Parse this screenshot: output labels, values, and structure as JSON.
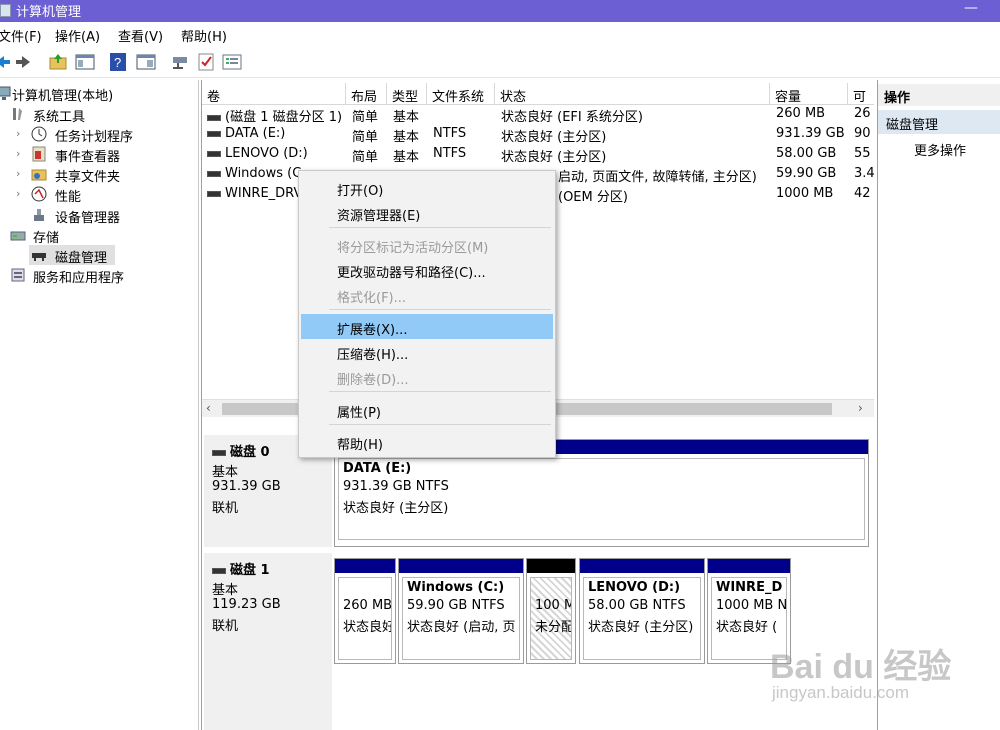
{
  "window": {
    "title": "计算机管理"
  },
  "menu": [
    "文件(F)",
    "操作(A)",
    "查看(V)",
    "帮助(H)"
  ],
  "tree": {
    "root": "计算机管理(本地)",
    "system_tools": "系统工具",
    "task_scheduler": "任务计划程序",
    "event_viewer": "事件查看器",
    "shared_folders": "共享文件夹",
    "performance": "性能",
    "device_manager": "设备管理器",
    "storage": "存储",
    "disk_management": "磁盘管理",
    "services_apps": "服务和应用程序"
  },
  "volume_list": {
    "columns": [
      "卷",
      "布局",
      "类型",
      "文件系统",
      "状态",
      "容量",
      "可"
    ],
    "rows": [
      {
        "volume": "(磁盘 1 磁盘分区 1)",
        "layout": "简单",
        "type": "基本",
        "fs": "",
        "status": "状态良好 (EFI 系统分区)",
        "capacity": "260 MB",
        "free": "26"
      },
      {
        "volume": "DATA (E:)",
        "layout": "简单",
        "type": "基本",
        "fs": "NTFS",
        "status": "状态良好 (主分区)",
        "capacity": "931.39 GB",
        "free": "90"
      },
      {
        "volume": "LENOVO (D:)",
        "layout": "简单",
        "type": "基本",
        "fs": "NTFS",
        "status": "状态良好 (主分区)",
        "capacity": "58.00 GB",
        "free": "55"
      },
      {
        "volume": "Windows (C",
        "layout": "",
        "type": "",
        "fs": "",
        "status": "启动, 页面文件, 故障转储, 主分区)",
        "capacity": "59.90 GB",
        "free": "3.4"
      },
      {
        "volume": "WINRE_DRV",
        "layout": "",
        "type": "",
        "fs": "",
        "status": "(OEM 分区)",
        "capacity": "1000 MB",
        "free": "42"
      }
    ]
  },
  "disks": [
    {
      "name": "磁盘 0",
      "kind": "基本",
      "size": "931.39 GB",
      "state": "联机",
      "partitions": [
        {
          "name": "DATA  (E:)",
          "line2": "931.39 GB NTFS",
          "line3": "状态良好 (主分区)"
        }
      ]
    },
    {
      "name": "磁盘 1",
      "kind": "基本",
      "size": "119.23 GB",
      "state": "联机",
      "partitions": [
        {
          "name": "",
          "line2": "260 MB",
          "line3": "状态良好"
        },
        {
          "name": "Windows  (C:)",
          "line2": "59.90 GB NTFS",
          "line3": "状态良好 (启动, 页"
        },
        {
          "name": "",
          "line2": "100 M",
          "line3": "未分配"
        },
        {
          "name": "LENOVO  (D:)",
          "line2": "58.00 GB NTFS",
          "line3": "状态良好 (主分区)"
        },
        {
          "name": "WINRE_D",
          "line2": "1000 MB N",
          "line3": "状态良好 ("
        }
      ]
    }
  ],
  "context_menu": {
    "open": "打开(O)",
    "explorer": "资源管理器(E)",
    "mark_active": "将分区标记为活动分区(M)",
    "change_letter": "更改驱动器号和路径(C)...",
    "format": "格式化(F)...",
    "extend": "扩展卷(X)...",
    "shrink": "压缩卷(H)...",
    "delete": "删除卷(D)...",
    "properties": "属性(P)",
    "help": "帮助(H)"
  },
  "actions": {
    "header": "操作",
    "selected": "磁盘管理",
    "more": "更多操作"
  },
  "watermark": {
    "brand": "Bai du 经验",
    "url": "jingyan.baidu.com"
  }
}
